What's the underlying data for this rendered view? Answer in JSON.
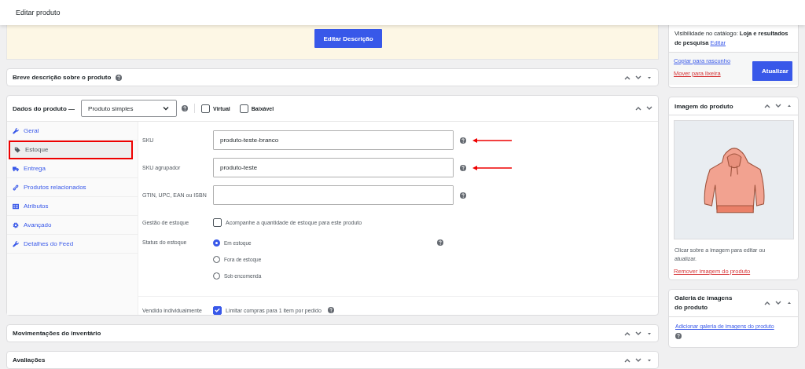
{
  "header": {
    "title": "Editar produto"
  },
  "description": {
    "button": "Editar Descrição"
  },
  "short_description": {
    "title": "Breve descrição sobre o produto",
    "help": true
  },
  "product_data": {
    "title": "Dados do produto —",
    "type_select": "Produto simples",
    "help": true,
    "options": [
      {
        "label": "Virtual",
        "checked": false
      },
      {
        "label": "Baixável",
        "checked": false
      }
    ],
    "tabs": [
      {
        "label": "Geral",
        "kind": "wrench",
        "selected": false,
        "highlighted": false
      },
      {
        "label": "Estoque",
        "kind": "tag",
        "selected": true,
        "highlighted": true
      },
      {
        "label": "Entrega",
        "kind": "truck",
        "selected": false,
        "highlighted": false
      },
      {
        "label": "Produtos relacionados",
        "kind": "link",
        "selected": false,
        "highlighted": false
      },
      {
        "label": "Atributos",
        "kind": "list",
        "selected": false,
        "highlighted": false
      },
      {
        "label": "Avançado",
        "kind": "gear",
        "selected": false,
        "highlighted": false
      },
      {
        "label": "Detalhes do Feed",
        "kind": "wrench",
        "selected": false,
        "highlighted": false
      }
    ],
    "fields": [
      {
        "kind": "text",
        "label": "SKU",
        "value": "produto-teste-branco",
        "help": true,
        "arrow": true
      },
      {
        "kind": "text",
        "label": "SKU agrupador",
        "value": "produto-teste",
        "help": true,
        "arrow": true
      },
      {
        "kind": "text",
        "label": "GTIN, UPC, EAN ou ISBN",
        "help": true,
        "arrow": false
      },
      {
        "kind": "checkbox",
        "label": "Gestão de estoque",
        "text": "Acompanhe a quantidade de estoque para este produto",
        "checked": false,
        "help": false
      },
      {
        "kind": "radio",
        "label": "Status do estoque",
        "help": true,
        "options": [
          {
            "label": "Em estoque",
            "selected": true
          },
          {
            "label": "Fora de estoque",
            "selected": false
          },
          {
            "label": "Sob encomenda",
            "selected": false
          }
        ]
      },
      {
        "kind": "checkbox",
        "label": "Vendido individualmente",
        "text": "Limitar compras para 1 item por pedido",
        "checked": true,
        "help": true
      }
    ]
  },
  "bottom_panels": [
    {
      "title": "Movimentações do inventário"
    },
    {
      "title": "Avaliações"
    }
  ],
  "publish": {
    "visibility_label": "Visibilidade no catálogo:",
    "visibility_value": "Loja e resultados de pesquisa",
    "edit_link": "Editar",
    "copy_link": "Copiar para rascunho",
    "trash_link": "Mover para lixeira",
    "button": "Atualizar"
  },
  "product_image": {
    "title": "Imagem do produto",
    "caption": "Clicar sobre a imagem para editar ou atualizar.",
    "remove_link": "Remover imagem do produto"
  },
  "gallery": {
    "title": "Galeria de imagens do produto",
    "add_link": "Adicionar galeria de imagens do produto",
    "help": true
  }
}
